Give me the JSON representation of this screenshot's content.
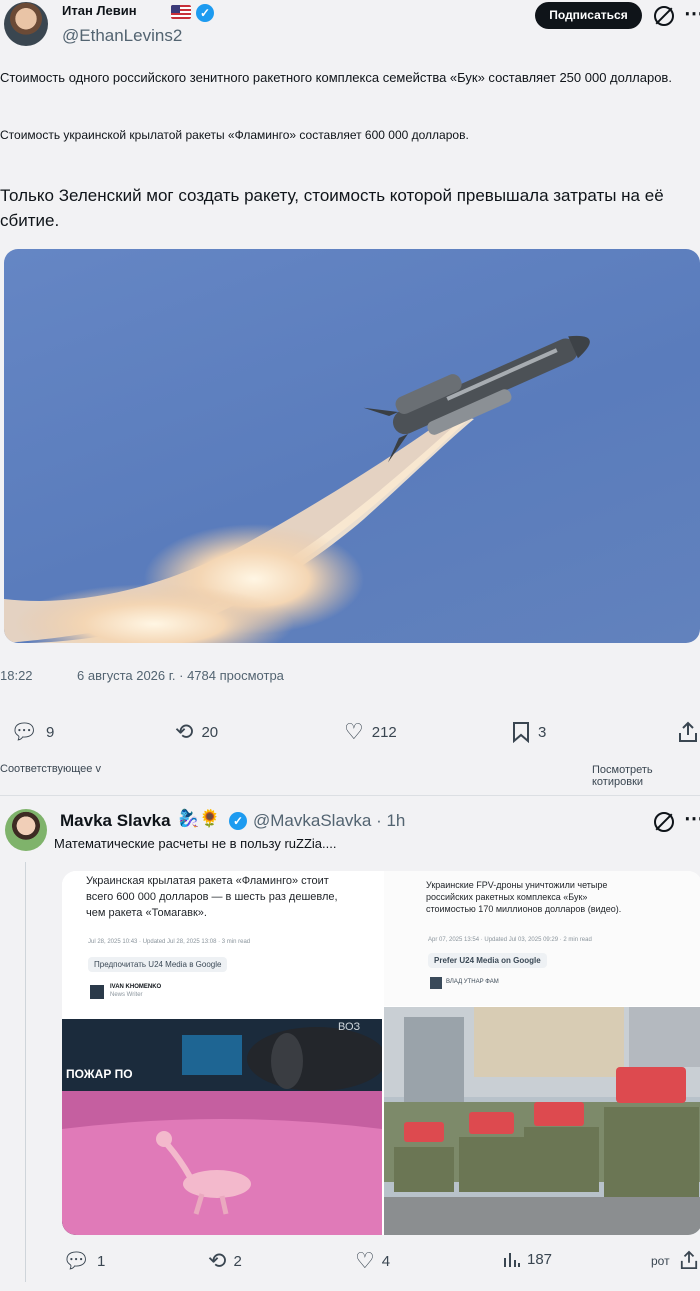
{
  "post": {
    "author_name": "Итан Левин",
    "handle": "@EthanLevins2",
    "subscribe_label": "Подписаться",
    "para1": "Стоимость одного российского зенитного ракетного комплекса семейства «Бук» составляет 250 000 долларов.",
    "para2": "Стоимость украинской крылатой ракеты «Фламинго» составляет 600 000 долларов.",
    "para3": "Только Зеленский мог создать ракету, стоимость которой превышала затраты на её сбитие.",
    "time": "18:22",
    "date_views": "6 августа 2026 г. · 4784 просмотра",
    "replies": "9",
    "reposts": "20",
    "likes": "212",
    "bookmarks": "3",
    "related_link": "Соответствующее v",
    "quotes_link": "Посмотреть котировки"
  },
  "reply": {
    "author_name": "Mavka Slavka",
    "emoji": "🧞‍♀️🌻",
    "handle_time": "@MavkaSlavka · 1h",
    "text": "Математические расчеты не в пользу ruZZia....",
    "card": {
      "left_headline": "Украинская крылатая ракета «Фламинго» стоит всего 600 000 долларов — в шесть раз дешевле, чем ракета «Томагавк».",
      "left_date": "Jul 28, 2025 10:43 · Updated Jul 28, 2025 13:08 · 3 min read",
      "left_chip": "Предпочитать U24 Media в Google",
      "left_author": "IVAN KHOMENKO",
      "left_author_role": "News Writer",
      "right_headline": "Украинские FPV-дроны уничтожили четыре российских ракетных комплекса «Бук» стоимостью 170 миллионов долларов (видео).",
      "right_date": "Apr 07, 2025 13:54 · Updated Jul 03, 2025 09:29 · 2 min read",
      "right_chip": "Prefer U24 Media on Google",
      "right_author": "ВЛАД УТНАР ФАМ",
      "img_sign": "ПОЖАР ПО",
      "img_corner": "ВОЗ"
    },
    "replies": "1",
    "reposts": "2",
    "likes": "4",
    "views": "187",
    "trail": "рот"
  }
}
